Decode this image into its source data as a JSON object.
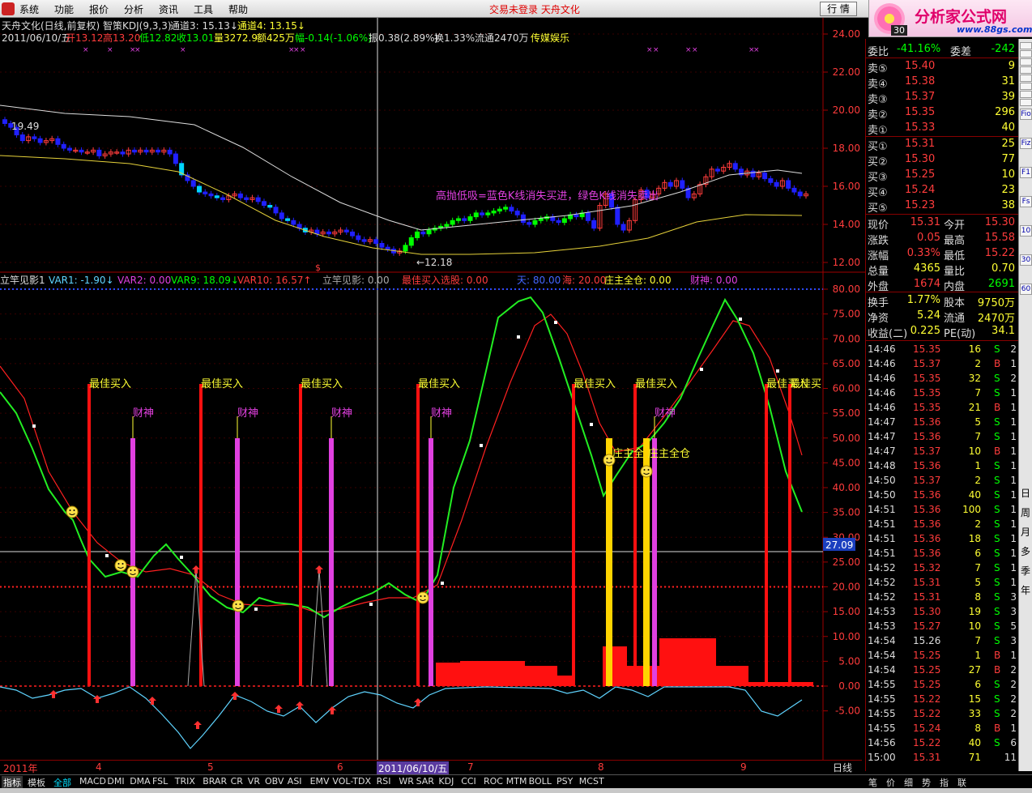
{
  "menu": [
    "系统",
    "功能",
    "报价",
    "分析",
    "资讯",
    "工具",
    "帮助"
  ],
  "login_status": "交易未登录 天舟文化",
  "quote_button": "行 情",
  "logo": {
    "name": "分析家公式网",
    "url": "www.88gs.com",
    "day": "30"
  },
  "header": {
    "title": "天舟文化(日线,前复权) 智策KDJ(9,3,3)",
    "ch3": "通道3: 15.13↓",
    "ch4": "通道4: 13.15↓",
    "date": "2011/06/10/五",
    "open": "开13.12",
    "high": "高13.20",
    "low": "低12.82",
    "close": "收13.01",
    "volume": "量3272.9",
    "amount": "额425万",
    "change": "幅-0.14(-1.06%)",
    "amplitude": "振0.38(2.89%)",
    "turnover": "换1.33%",
    "float": "流通2470万",
    "industry": "传媒娱乐"
  },
  "annotations": {
    "price_max": "19.49",
    "price_min": "←12.18",
    "strategy": "高抛低吸=蓝色K线消失买进，绿色K线消失卖出",
    "buy_label": "最佳买入",
    "god_label": "财神",
    "hold_label": "庄主全仓",
    "hold_label_b": "庄主全仓",
    "hold_label_c": "庄主全",
    "cut_label": "最佳买",
    "level": "27.09"
  },
  "indicator_header": {
    "name": "立竿见影1",
    "var1": "VAR1: -1.90↓",
    "var2": "VAR2: 0.00",
    "var9": "VAR9: 18.09↓",
    "var10": "VAR10: 16.57↑",
    "ljy": "立竿见影: 0.00",
    "best": "最佳买入选股: 0.00",
    "tian": "天: 80.00",
    "hai": "海: 20.00",
    "zhuang": "庄主全仓: 0.00",
    "caishen": "财神: 0.00"
  },
  "price_axis": [
    "24.00",
    "22.00",
    "20.00",
    "18.00",
    "16.00",
    "14.00",
    "12.00"
  ],
  "ind_axis": [
    "80.00",
    "75.00",
    "70.00",
    "65.00",
    "60.00",
    "55.00",
    "50.00",
    "45.00",
    "40.00",
    "35.00",
    "30.00",
    "25.00",
    "20.00",
    "15.00",
    "10.00",
    "5.00",
    "0.00",
    "-5.00"
  ],
  "panel": {
    "weibi": {
      "label": "委比",
      "value": "-41.16%",
      "cha_label": "委差",
      "cha": "-242"
    },
    "asks": [
      {
        "label": "卖⑤",
        "price": "15.40",
        "vol": "9"
      },
      {
        "label": "卖④",
        "price": "15.38",
        "vol": "31"
      },
      {
        "label": "卖③",
        "price": "15.37",
        "vol": "39"
      },
      {
        "label": "卖②",
        "price": "15.35",
        "vol": "296"
      },
      {
        "label": "卖①",
        "price": "15.33",
        "vol": "40"
      }
    ],
    "bids": [
      {
        "label": "买①",
        "price": "15.31",
        "vol": "25"
      },
      {
        "label": "买②",
        "price": "15.30",
        "vol": "77"
      },
      {
        "label": "买③",
        "price": "15.25",
        "vol": "10"
      },
      {
        "label": "买④",
        "price": "15.24",
        "vol": "23"
      },
      {
        "label": "买⑤",
        "price": "15.23",
        "vol": "38"
      }
    ],
    "stats1": [
      {
        "l1": "现价",
        "v1": "15.31",
        "l2": "今开",
        "v2": "15.30"
      },
      {
        "l1": "涨跌",
        "v1": "0.05",
        "l2": "最高",
        "v2": "15.58"
      },
      {
        "l1": "涨幅",
        "v1": "0.33%",
        "l2": "最低",
        "v2": "15.22"
      },
      {
        "l1": "总量",
        "v1": "4365",
        "l2": "量比",
        "v2": "0.70"
      },
      {
        "l1": "外盘",
        "v1": "1674",
        "l2": "内盘",
        "v2": "2691"
      }
    ],
    "stats2": [
      {
        "l1": "换手",
        "v1": "1.77%",
        "l2": "股本",
        "v2": "9750万"
      },
      {
        "l1": "净资",
        "v1": "5.24",
        "l2": "流通",
        "v2": "2470万"
      },
      {
        "l1": "收益(二)",
        "v1": "0.225",
        "l2": "PE(动)",
        "v2": "34.1"
      }
    ],
    "ticks": [
      {
        "t": "14:46",
        "p": "15.35",
        "v": "16",
        "s": "S",
        "n": "2"
      },
      {
        "t": "14:46",
        "p": "15.37",
        "v": "2",
        "s": "B",
        "n": "1"
      },
      {
        "t": "14:46",
        "p": "15.35",
        "v": "32",
        "s": "S",
        "n": "2"
      },
      {
        "t": "14:46",
        "p": "15.35",
        "v": "7",
        "s": "S",
        "n": "1"
      },
      {
        "t": "14:46",
        "p": "15.35",
        "v": "21",
        "s": "B",
        "n": "1"
      },
      {
        "t": "14:47",
        "p": "15.36",
        "v": "5",
        "s": "S",
        "n": "1"
      },
      {
        "t": "14:47",
        "p": "15.36",
        "v": "7",
        "s": "S",
        "n": "1"
      },
      {
        "t": "14:47",
        "p": "15.37",
        "v": "10",
        "s": "B",
        "n": "1"
      },
      {
        "t": "14:48",
        "p": "15.36",
        "v": "1",
        "s": "S",
        "n": "1"
      },
      {
        "t": "14:50",
        "p": "15.37",
        "v": "2",
        "s": "S",
        "n": "1"
      },
      {
        "t": "14:50",
        "p": "15.36",
        "v": "40",
        "s": "S",
        "n": "1"
      },
      {
        "t": "14:51",
        "p": "15.36",
        "v": "100",
        "s": "S",
        "n": "1"
      },
      {
        "t": "14:51",
        "p": "15.36",
        "v": "2",
        "s": "S",
        "n": "1"
      },
      {
        "t": "14:51",
        "p": "15.36",
        "v": "18",
        "s": "S",
        "n": "1"
      },
      {
        "t": "14:51",
        "p": "15.36",
        "v": "6",
        "s": "S",
        "n": "1"
      },
      {
        "t": "14:52",
        "p": "15.32",
        "v": "7",
        "s": "S",
        "n": "1"
      },
      {
        "t": "14:52",
        "p": "15.31",
        "v": "5",
        "s": "S",
        "n": "1"
      },
      {
        "t": "14:52",
        "p": "15.31",
        "v": "8",
        "s": "S",
        "n": "3"
      },
      {
        "t": "14:53",
        "p": "15.30",
        "v": "19",
        "s": "S",
        "n": "3"
      },
      {
        "t": "14:53",
        "p": "15.27",
        "v": "10",
        "s": "S",
        "n": "5"
      },
      {
        "t": "14:54",
        "p": "15.26",
        "v": "7",
        "s": "S",
        "n": "3"
      },
      {
        "t": "14:54",
        "p": "15.25",
        "v": "1",
        "s": "B",
        "n": "1"
      },
      {
        "t": "14:54",
        "p": "15.25",
        "v": "27",
        "s": "B",
        "n": "2"
      },
      {
        "t": "14:55",
        "p": "15.25",
        "v": "6",
        "s": "S",
        "n": "2"
      },
      {
        "t": "14:55",
        "p": "15.22",
        "v": "15",
        "s": "S",
        "n": "2"
      },
      {
        "t": "14:55",
        "p": "15.22",
        "v": "33",
        "s": "S",
        "n": "2"
      },
      {
        "t": "14:55",
        "p": "15.24",
        "v": "8",
        "s": "B",
        "n": "1"
      },
      {
        "t": "14:56",
        "p": "15.22",
        "v": "40",
        "s": "S",
        "n": "6"
      },
      {
        "t": "15:00",
        "p": "15.31",
        "v": "71",
        "s": "",
        "n": "11"
      }
    ]
  },
  "right_toolbar": [
    "Fio",
    "Fiz",
    "F1",
    "Fs",
    "10",
    "30",
    "60",
    "日",
    "周",
    "月",
    "多",
    "季",
    "年"
  ],
  "dates": [
    "2011年",
    "4",
    "5",
    "6",
    "2011/06/10/五",
    "7",
    "8",
    "9"
  ],
  "period": "日线",
  "tabs": [
    "指标",
    "模板",
    "全部",
    "MACD",
    "DMI",
    "DMA",
    "FSL",
    "TRIX",
    "BRAR",
    "CR",
    "VR",
    "OBV",
    "ASI",
    "EMV",
    "VOL-TDX",
    "RSI",
    "WR",
    "SAR",
    "KDJ",
    "CCI",
    "ROC",
    "MTM",
    "BOLL",
    "PSY",
    "MCST"
  ],
  "panel_tabs": [
    "笔",
    "价",
    "细",
    "势",
    "指",
    "联"
  ],
  "colors": {
    "up": "#ff3c3c",
    "down": "#0000ff",
    "green": "#00ff00",
    "magenta": "#e040e0",
    "yellow": "#ffff33",
    "cyan": "#5fd4ff"
  }
}
